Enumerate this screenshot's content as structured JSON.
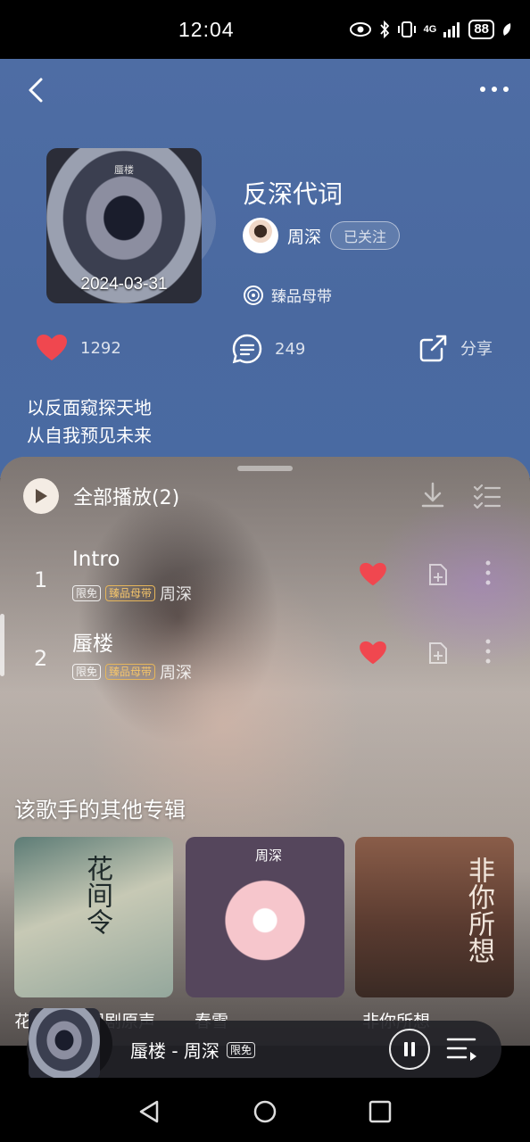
{
  "status_bar": {
    "time": "12:04",
    "network": "4G",
    "battery": "88"
  },
  "header": {
    "back_label": "back",
    "more_label": "more"
  },
  "album": {
    "title": "反深代词",
    "cover_text": "蜃楼",
    "release_date": "2024-03-31",
    "artist": "周深",
    "follow_label": "已关注",
    "quality_label": "臻品母带",
    "likes": "1292",
    "comments": "249",
    "share_label": "分享",
    "description_lines": [
      "以反面窥探天地",
      "从自我预见未来"
    ]
  },
  "tracklist": {
    "play_all_label": "全部播放(2)",
    "tracks": [
      {
        "number": "1",
        "title": "Intro",
        "tag_free": "限免",
        "tag_quality": "臻品母带",
        "artist": "周深"
      },
      {
        "number": "2",
        "title": "蜃楼",
        "tag_free": "限免",
        "tag_quality": "臻品母带",
        "artist": "周深"
      }
    ]
  },
  "other_albums": {
    "title": "该歌手的其他专辑",
    "items": [
      {
        "cover_text": "花间令",
        "label": "花间令 电视剧原声"
      },
      {
        "cover_text": "周深",
        "label": "春雪"
      },
      {
        "cover_text": "非你所想",
        "label": "非你所想"
      }
    ]
  },
  "mini_player": {
    "title": "蜃楼 - 周深",
    "tag": "限免"
  },
  "colors": {
    "header_bg": "#4e6da4",
    "heart": "#f0474f",
    "gold_tag": "#e7b65a"
  }
}
